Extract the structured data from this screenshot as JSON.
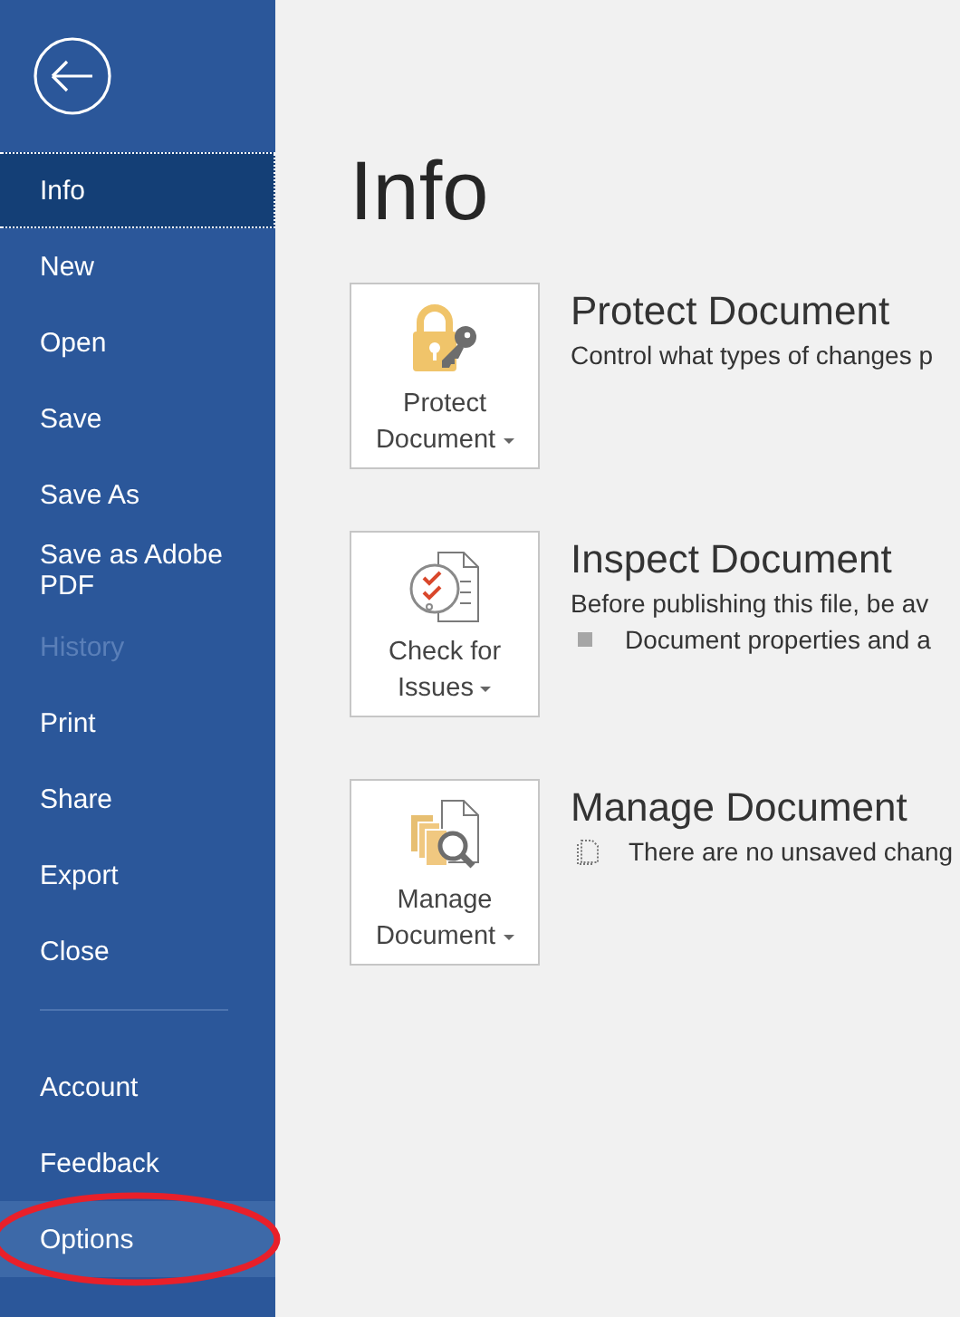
{
  "sidebar": {
    "items": [
      {
        "label": "Info",
        "kind": "item",
        "selected": true,
        "disabled": false,
        "hovered": false,
        "circled": false
      },
      {
        "label": "New",
        "kind": "item",
        "selected": false,
        "disabled": false,
        "hovered": false,
        "circled": false
      },
      {
        "label": "Open",
        "kind": "item",
        "selected": false,
        "disabled": false,
        "hovered": false,
        "circled": false
      },
      {
        "label": "Save",
        "kind": "item",
        "selected": false,
        "disabled": false,
        "hovered": false,
        "circled": false
      },
      {
        "label": "Save As",
        "kind": "item",
        "selected": false,
        "disabled": false,
        "hovered": false,
        "circled": false
      },
      {
        "label": "Save as Adobe PDF",
        "kind": "item",
        "selected": false,
        "disabled": false,
        "hovered": false,
        "circled": false
      },
      {
        "label": "History",
        "kind": "item",
        "selected": false,
        "disabled": true,
        "hovered": false,
        "circled": false
      },
      {
        "label": "Print",
        "kind": "item",
        "selected": false,
        "disabled": false,
        "hovered": false,
        "circled": false
      },
      {
        "label": "Share",
        "kind": "item",
        "selected": false,
        "disabled": false,
        "hovered": false,
        "circled": false
      },
      {
        "label": "Export",
        "kind": "item",
        "selected": false,
        "disabled": false,
        "hovered": false,
        "circled": false
      },
      {
        "label": "Close",
        "kind": "item",
        "selected": false,
        "disabled": false,
        "hovered": false,
        "circled": false
      },
      {
        "kind": "separator"
      },
      {
        "label": "Account",
        "kind": "item",
        "selected": false,
        "disabled": false,
        "hovered": false,
        "circled": false
      },
      {
        "label": "Feedback",
        "kind": "item",
        "selected": false,
        "disabled": false,
        "hovered": false,
        "circled": false
      },
      {
        "label": "Options",
        "kind": "item",
        "selected": false,
        "disabled": false,
        "hovered": true,
        "circled": true
      }
    ]
  },
  "page_title": "Info",
  "sections": [
    {
      "kind": "protect",
      "button_lines": [
        "Protect",
        "Document"
      ],
      "heading": "Protect Document",
      "text": "Control what types of changes p"
    },
    {
      "kind": "inspect",
      "button_lines": [
        "Check for",
        "Issues"
      ],
      "heading": "Inspect Document",
      "text": "Before publishing this file, be av",
      "bullets": [
        {
          "kind": "square",
          "text": "Document properties and a"
        }
      ]
    },
    {
      "kind": "manage",
      "button_lines": [
        "Manage",
        "Document"
      ],
      "heading": "Manage Document",
      "bullets": [
        {
          "kind": "file",
          "text": "There are no unsaved chang"
        }
      ]
    }
  ]
}
